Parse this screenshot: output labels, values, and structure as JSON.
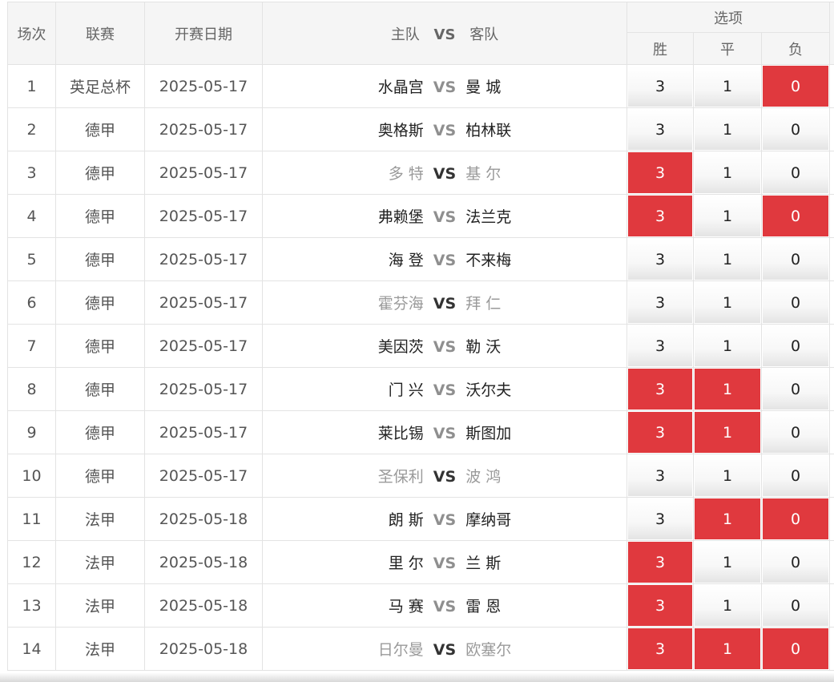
{
  "header": {
    "col_index": "场次",
    "col_league": "联赛",
    "col_date": "开赛日期",
    "col_match_home": "主队",
    "col_match_vs": "VS",
    "col_match_away": "客队",
    "col_options": "选项",
    "opt_win": "胜",
    "opt_draw": "平",
    "opt_lose": "负"
  },
  "vs_text": "VS",
  "option_values": {
    "win": "3",
    "draw": "1",
    "lose": "0"
  },
  "colors": {
    "selected": "#e0393e",
    "header_bg": "#f5f5f5"
  },
  "rows": [
    {
      "index": "1",
      "league": "英足总杯",
      "date": "2025-05-17",
      "home": "水晶宫",
      "away": "曼 城",
      "dim": false,
      "sel": [
        false,
        false,
        true
      ]
    },
    {
      "index": "2",
      "league": "德甲",
      "date": "2025-05-17",
      "home": "奥格斯",
      "away": "柏林联",
      "dim": false,
      "sel": [
        false,
        false,
        false
      ]
    },
    {
      "index": "3",
      "league": "德甲",
      "date": "2025-05-17",
      "home": "多 特",
      "away": "基 尔",
      "dim": true,
      "sel": [
        true,
        false,
        false
      ]
    },
    {
      "index": "4",
      "league": "德甲",
      "date": "2025-05-17",
      "home": "弗赖堡",
      "away": "法兰克",
      "dim": false,
      "sel": [
        true,
        false,
        true
      ]
    },
    {
      "index": "5",
      "league": "德甲",
      "date": "2025-05-17",
      "home": "海 登",
      "away": "不来梅",
      "dim": false,
      "sel": [
        false,
        false,
        false
      ]
    },
    {
      "index": "6",
      "league": "德甲",
      "date": "2025-05-17",
      "home": "霍芬海",
      "away": "拜 仁",
      "dim": true,
      "sel": [
        false,
        false,
        false
      ]
    },
    {
      "index": "7",
      "league": "德甲",
      "date": "2025-05-17",
      "home": "美因茨",
      "away": "勒 沃",
      "dim": false,
      "sel": [
        false,
        false,
        false
      ]
    },
    {
      "index": "8",
      "league": "德甲",
      "date": "2025-05-17",
      "home": "门 兴",
      "away": "沃尔夫",
      "dim": false,
      "sel": [
        true,
        true,
        false
      ]
    },
    {
      "index": "9",
      "league": "德甲",
      "date": "2025-05-17",
      "home": "莱比锡",
      "away": "斯图加",
      "dim": false,
      "sel": [
        true,
        true,
        false
      ]
    },
    {
      "index": "10",
      "league": "德甲",
      "date": "2025-05-17",
      "home": "圣保利",
      "away": "波 鸿",
      "dim": true,
      "sel": [
        false,
        false,
        false
      ]
    },
    {
      "index": "11",
      "league": "法甲",
      "date": "2025-05-18",
      "home": "朗 斯",
      "away": "摩纳哥",
      "dim": false,
      "sel": [
        false,
        true,
        true
      ]
    },
    {
      "index": "12",
      "league": "法甲",
      "date": "2025-05-18",
      "home": "里 尔",
      "away": "兰 斯",
      "dim": false,
      "sel": [
        true,
        false,
        false
      ]
    },
    {
      "index": "13",
      "league": "法甲",
      "date": "2025-05-18",
      "home": "马 赛",
      "away": "雷 恩",
      "dim": false,
      "sel": [
        true,
        false,
        false
      ]
    },
    {
      "index": "14",
      "league": "法甲",
      "date": "2025-05-18",
      "home": "日尔曼",
      "away": "欧塞尔",
      "dim": true,
      "sel": [
        true,
        true,
        true
      ]
    }
  ]
}
